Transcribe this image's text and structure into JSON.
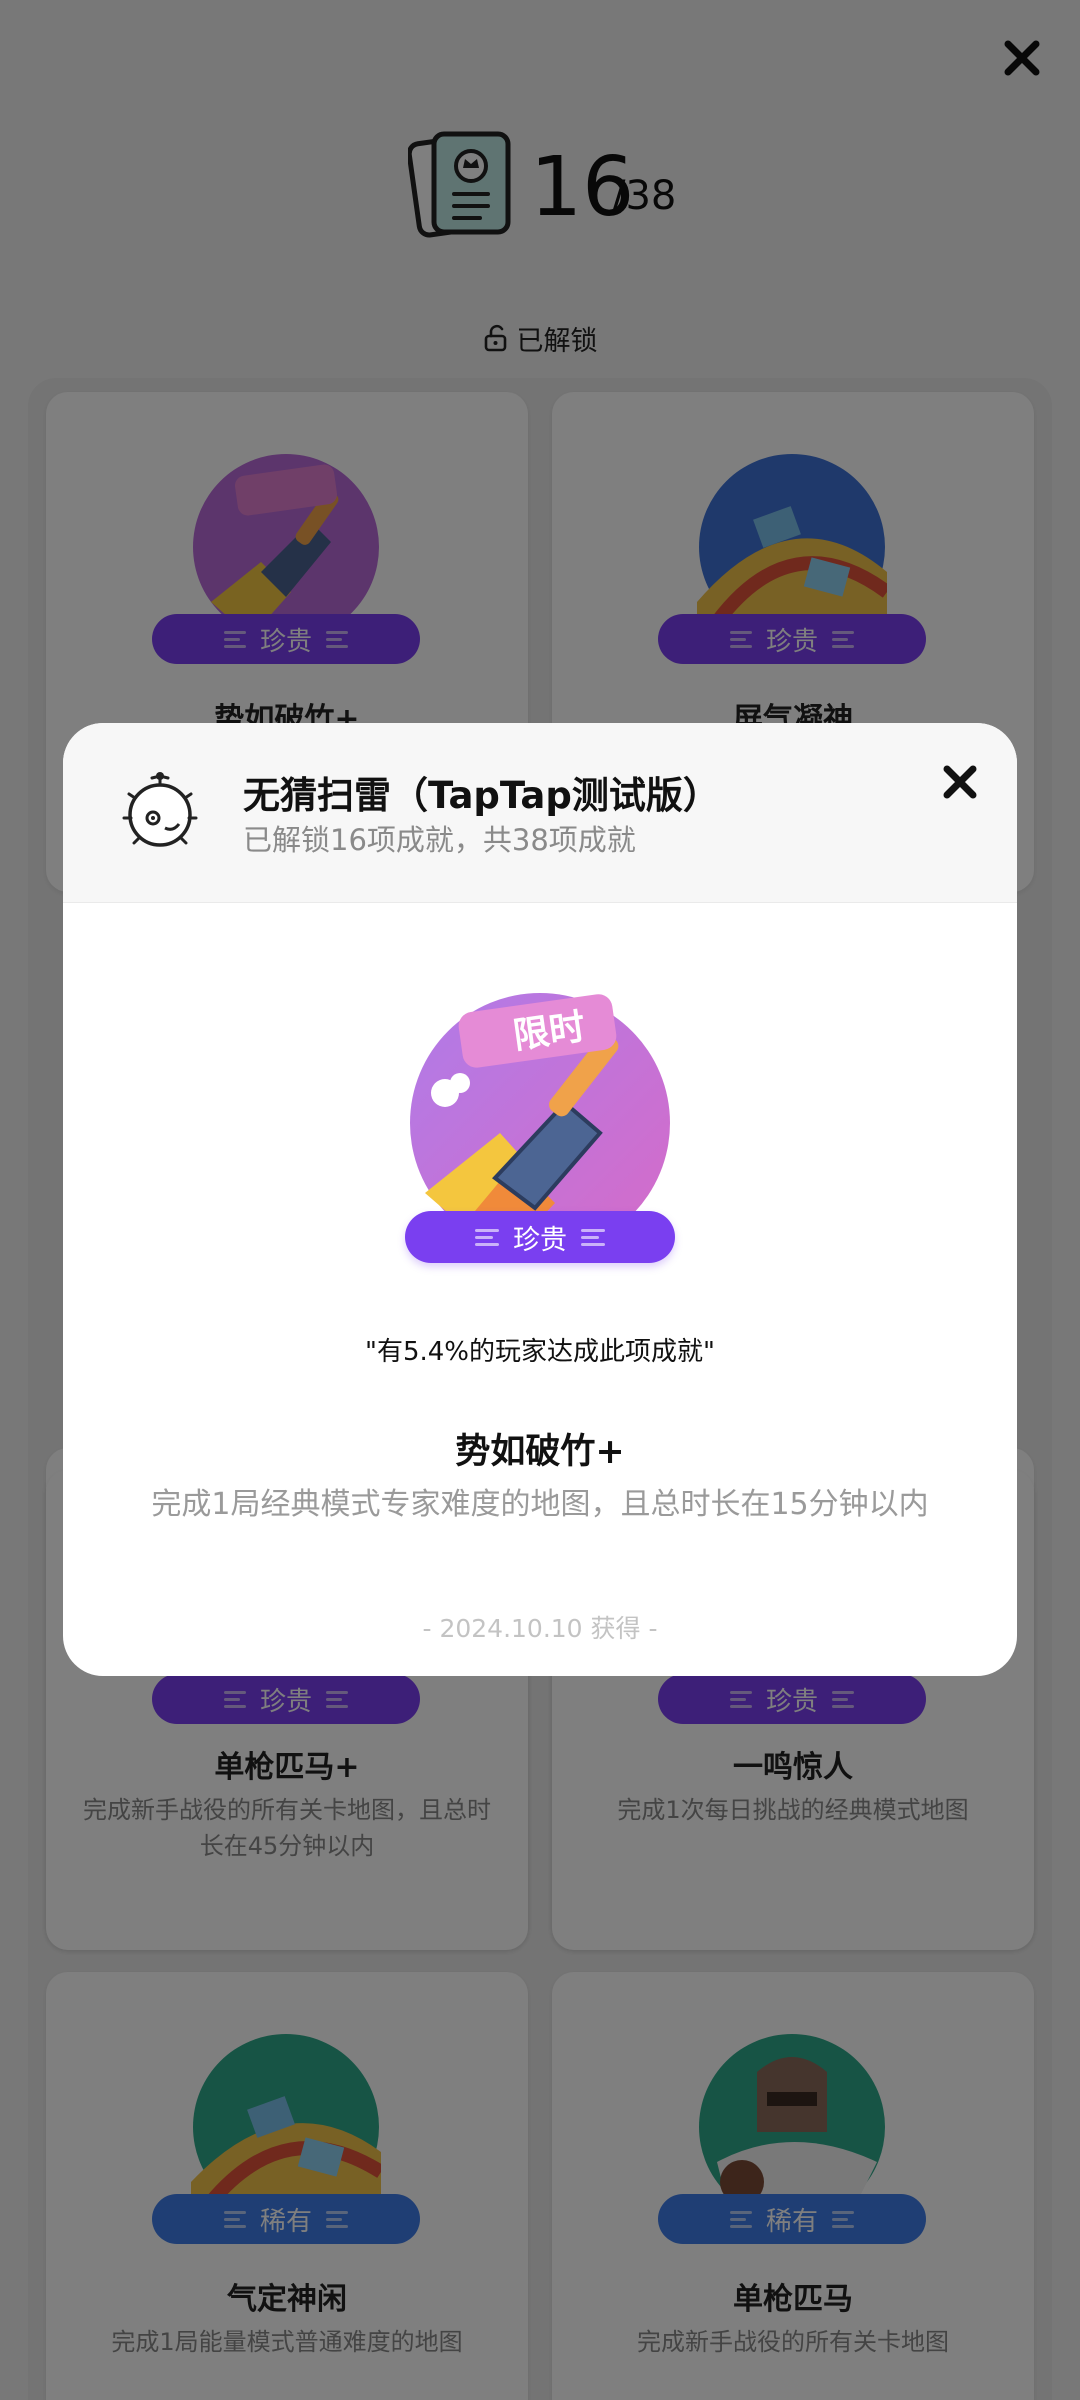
{
  "progress": {
    "count": "16",
    "total": "/38"
  },
  "unlocked_label": "已解锁",
  "cards": [
    {
      "rarity": "珍贵",
      "title": "势如破竹+",
      "desc": ""
    },
    {
      "rarity": "珍贵",
      "title": "屏气凝神",
      "desc": ""
    },
    {
      "rarity": "珍贵",
      "title": "单枪匹马+",
      "desc": "完成新手战役的所有关卡地图，且总时长在45分钟以内"
    },
    {
      "rarity": "珍贵",
      "title": "一鸣惊人",
      "desc": "完成1次每日挑战的经典模式地图"
    },
    {
      "rarity": "稀有",
      "title": "气定神闲",
      "desc": "完成1局能量模式普通难度的地图"
    },
    {
      "rarity": "稀有",
      "title": "单枪匹马",
      "desc": "完成新手战役的所有关卡地图"
    }
  ],
  "modal": {
    "game_title": "无猜扫雷（TapTap测试版）",
    "game_subtitle": "已解锁16项成就，共38项成就",
    "badge_tag": "限时",
    "rarity": "珍贵",
    "stat": "\"有5.4%的玩家达成此项成就\"",
    "title": "势如破竹+",
    "description": "完成1局经典模式专家难度的地图，且总时长在15分钟以内",
    "date": "- 2024.10.10 获得 -"
  },
  "colors": {
    "rare_purple": "#7a3ff0",
    "uncommon_blue": "#3f7ce8",
    "overlay": "rgba(0,0,0,0.5)"
  },
  "icons": [
    "close-icon",
    "achievement-card-icon",
    "unlock-icon",
    "minesweeper-logo-icon"
  ]
}
